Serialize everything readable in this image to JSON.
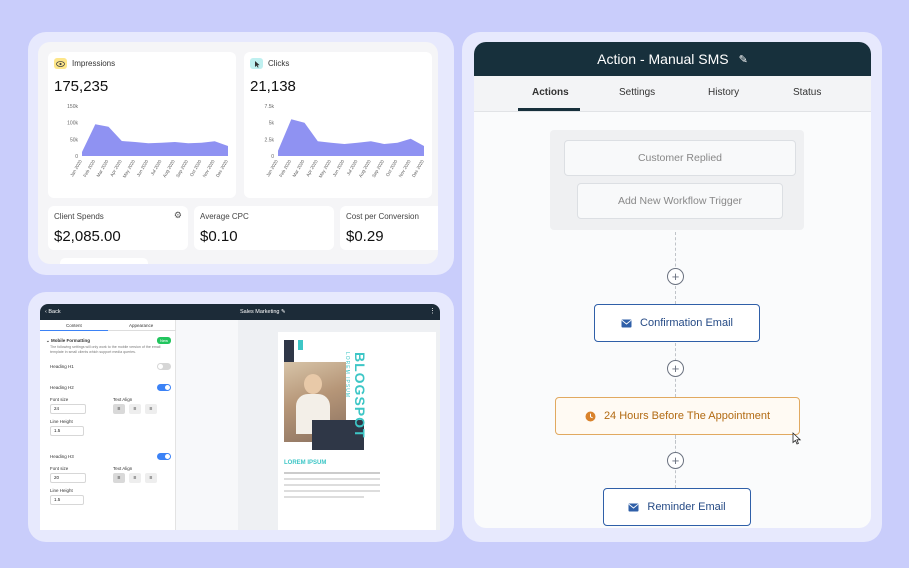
{
  "dashboard": {
    "impressions": {
      "label": "Impressions",
      "value": "175,235",
      "yticks": [
        "150k",
        "100k",
        "50k",
        "0"
      ],
      "months": [
        "Jan 2020",
        "Feb 2020",
        "Mar 2020",
        "Apr 2020",
        "May 2020",
        "Jun 2020",
        "Jul 2020",
        "Aug 2020",
        "Sep 2020",
        "Oct 2020",
        "Nov 2020",
        "Dec 2020"
      ],
      "series": [
        12,
        95,
        88,
        45,
        42,
        38,
        40,
        42,
        38,
        40,
        44,
        30
      ]
    },
    "clicks": {
      "label": "Clicks",
      "value": "21,138",
      "yticks": [
        "7.5k",
        "5k",
        "2.5k",
        "0"
      ],
      "months": [
        "Jan 2020",
        "Feb 2020",
        "Mar 2020",
        "Apr 2020",
        "May 2020",
        "Jun 2020",
        "Jul 2020",
        "Aug 2020",
        "Sep 2020",
        "Oct 2020",
        "Nov 2020",
        "Dec 2020"
      ],
      "series": [
        0.8,
        5.5,
        5.0,
        2.2,
        2.0,
        1.8,
        2.0,
        2.2,
        1.8,
        2.0,
        2.6,
        1.5
      ]
    },
    "stats": [
      {
        "label": "Client Spends",
        "value": "$2,085.00"
      },
      {
        "label": "Average CPC",
        "value": "$0.10"
      },
      {
        "label": "Cost per Conversion",
        "value": "$0.29"
      }
    ],
    "colors": {
      "accent": "#7b7ff0",
      "impressions_icon_bg": "#fde68a",
      "clicks_icon_bg": "#bff0f0"
    }
  },
  "editor": {
    "back": "Back",
    "title": "Sales Marketing",
    "tabs": [
      "Content",
      "Appearance"
    ],
    "section": "Mobile Formatting",
    "badge": "New",
    "description": "The following settings will only work to the mobile version of the email template in small clients which support media queries.",
    "h1": {
      "label": "Heading H1"
    },
    "h2": {
      "label": "Heading H2",
      "font_size_label": "Font size",
      "font_size": "24",
      "align_label": "Text Align",
      "line_height_label": "Line Height",
      "line_height": "1.5"
    },
    "h3": {
      "label": "Heading H3",
      "font_size_label": "Font size",
      "font_size": "20",
      "align_label": "Text Align",
      "line_height_label": "Line Height",
      "line_height": "1.5"
    },
    "preview": {
      "title": "BLOGSPOT",
      "subtitle": "LOREM IPSUM",
      "headline": "LOREM IPSUM"
    }
  },
  "workflow": {
    "title": "Action - Manual SMS",
    "tabs": [
      "Actions",
      "Settings",
      "History",
      "Status"
    ],
    "triggers": [
      "Customer Replied",
      "Add New Workflow Trigger"
    ],
    "nodes": [
      {
        "label": "Confirmation Email",
        "icon": "envelope-icon"
      },
      {
        "label": "24 Hours Before The Appointment",
        "icon": "clock-icon"
      },
      {
        "label": "Reminder Email",
        "icon": "envelope-icon"
      }
    ],
    "plus": "+",
    "colors": {
      "header": "#17303c",
      "email": "#2f5fa8",
      "wait": "#e1a960"
    }
  }
}
